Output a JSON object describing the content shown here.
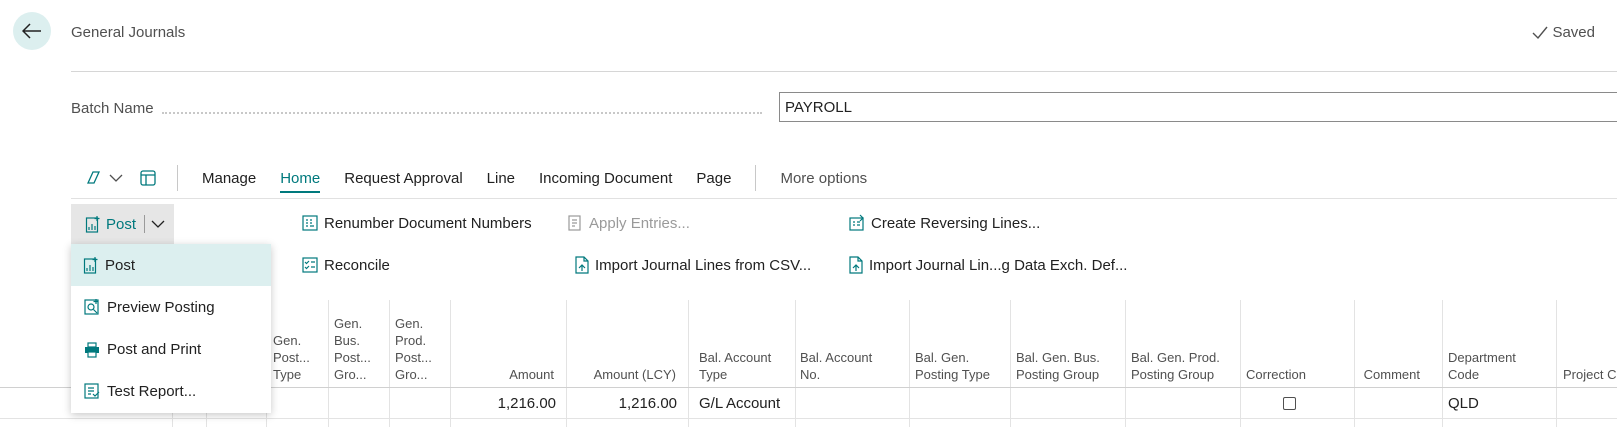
{
  "header": {
    "title": "General Journals",
    "saved": "Saved"
  },
  "batch": {
    "label": "Batch Name",
    "value": "PAYROLL"
  },
  "actionbar": {
    "menus": [
      "Manage",
      "Home",
      "Request Approval",
      "Line",
      "Incoming Document",
      "Page"
    ],
    "active": "Home",
    "more": "More options"
  },
  "actions": {
    "post": "Post",
    "renumber": "Renumber Document Numbers",
    "apply_entries": "Apply Entries...",
    "create_reversing": "Create Reversing Lines...",
    "reconcile": "Reconcile",
    "import_csv": "Import Journal Lines from CSV...",
    "import_data_exch": "Import Journal Lin...g Data Exch. Def..."
  },
  "post_menu": [
    "Post",
    "Preview Posting",
    "Post and Print",
    "Test Report..."
  ],
  "columns": {
    "gen_posting_type": [
      "Gen.",
      "Post...",
      "Type"
    ],
    "gen_bus_posting_group": [
      "Gen.",
      "Bus.",
      "Post...",
      "Gro..."
    ],
    "gen_prod_posting_group": [
      "Gen.",
      "Prod.",
      "Post...",
      "Gro..."
    ],
    "amount": [
      "Amount"
    ],
    "amount_lcy": [
      "Amount (LCY)"
    ],
    "bal_account_type": [
      "Bal. Account",
      "Type"
    ],
    "bal_account_no": [
      "Bal. Account",
      "No."
    ],
    "bal_gen_posting_type": [
      "Bal. Gen.",
      "Posting Type"
    ],
    "bal_gen_bus_posting_group": [
      "Bal. Gen. Bus.",
      "Posting Group"
    ],
    "bal_gen_prod_posting_group": [
      "Bal. Gen. Prod.",
      "Posting Group"
    ],
    "correction": [
      "Correction"
    ],
    "comment": [
      "Comment"
    ],
    "department_code": [
      "Department",
      "Code"
    ],
    "project_code": [
      "Project C"
    ]
  },
  "row": {
    "amount": "1,216.00",
    "amount_lcy": "1,216.00",
    "bal_account_type": "G/L Account",
    "department_code": "QLD",
    "correction": false
  },
  "colors": {
    "accent": "#00797d",
    "highlight": "#dcefef"
  }
}
